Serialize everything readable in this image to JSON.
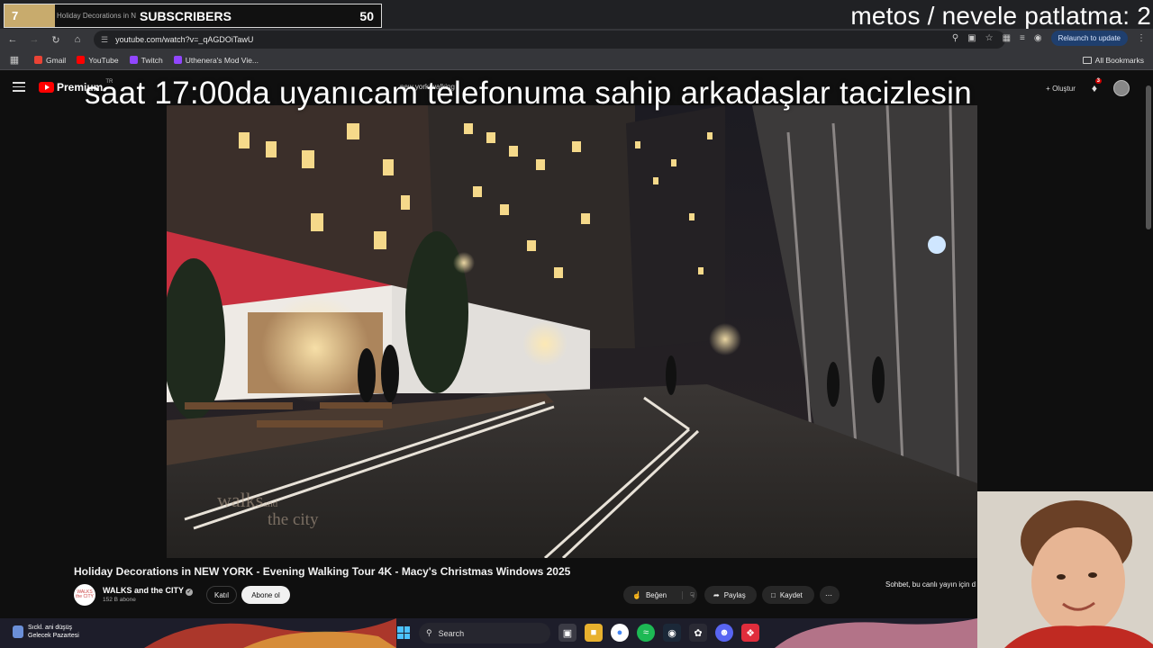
{
  "overlay": {
    "subscriber_number": "7",
    "tab_title": "Holiday Decorations in N",
    "subscribers_label": "SUBSCRIBERS",
    "subscribers_count": "50",
    "ticker_text": "metos / nevele patlatma: 2",
    "caption": "saat 17:00da uyanıcam telefonuma sahip arkadaşlar tacizlesin"
  },
  "browser": {
    "url": "youtube.com/watch?v=_qAGDOiTawU",
    "relaunch_label": "Relaunch to update",
    "bookmarks": [
      {
        "label": "Gmail",
        "color": "#ea4335"
      },
      {
        "label": "YouTube",
        "color": "#ff0000"
      },
      {
        "label": "Twitch",
        "color": "#9146ff"
      },
      {
        "label": "Uthenera's Mod Vie...",
        "color": "#9146ff"
      }
    ],
    "all_bookmarks_label": "All Bookmarks"
  },
  "youtube": {
    "logo_label": "Premium",
    "logo_region": "TR",
    "search_query": "new york walking",
    "create_label": "Oluştur",
    "notification_count": "3",
    "video_title": "Holiday Decorations in NEW YORK - Evening Walking Tour 4K - Macy's Christmas Windows 2025",
    "channel_name": "WALKS and the CITY",
    "channel_avatar_text": "WALKS the CITY",
    "channel_subs": "152 B abone",
    "join_label": "Katıl",
    "subscribe_label": "Abone ol",
    "like_label": "Beğen",
    "share_label": "Paylaş",
    "save_label": "Kaydet",
    "chat_text": "Sohbet, bu canlı yayın için d",
    "watermark_top": "walks",
    "watermark_and": "and",
    "watermark_bottom": "the city"
  },
  "taskbar": {
    "weather_line1": "Sıckl. ani düşüş",
    "weather_line2": "Gelecek Pazartesi",
    "search_label": "Search"
  }
}
